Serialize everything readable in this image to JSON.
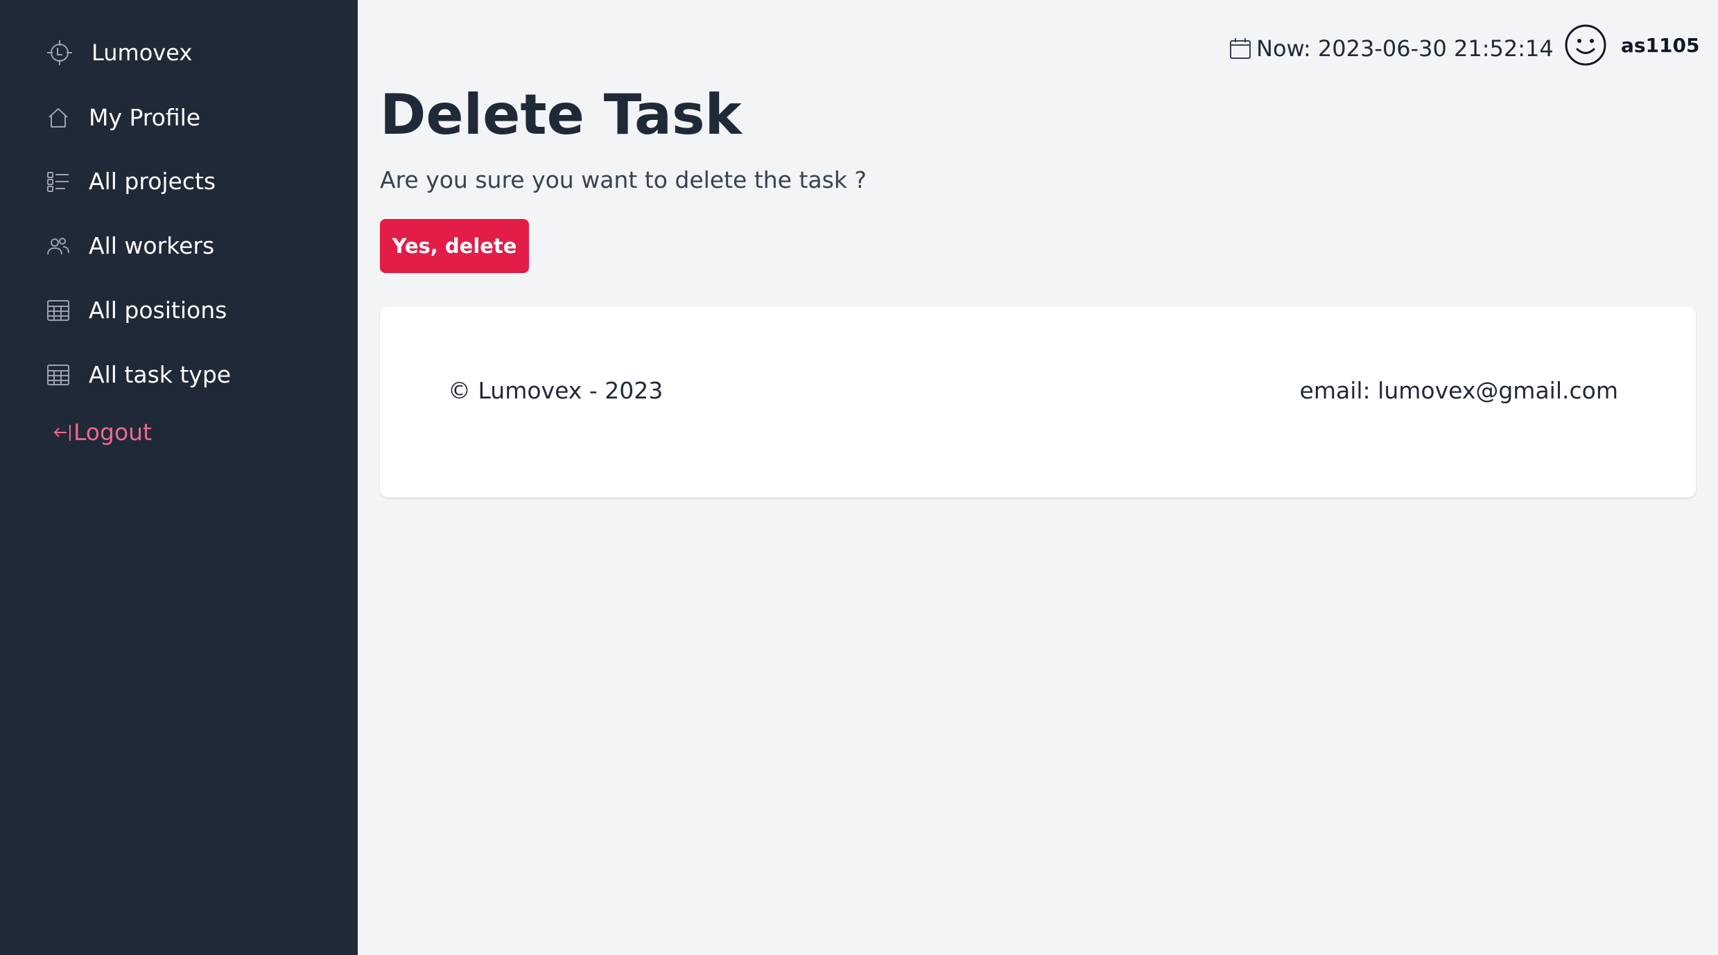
{
  "sidebar": {
    "brand": {
      "label": "Lumovex",
      "icon": "crosshair-clock-icon"
    },
    "items": [
      {
        "label": "My Profile",
        "icon": "home-icon"
      },
      {
        "label": "All projects",
        "icon": "checklist-icon"
      },
      {
        "label": "All workers",
        "icon": "users-icon"
      },
      {
        "label": "All positions",
        "icon": "table-icon"
      },
      {
        "label": "All task type",
        "icon": "table-icon"
      }
    ],
    "logout": {
      "label": "Logout",
      "icon": "logout-arrow-icon"
    }
  },
  "header": {
    "date_label": "Now: 2023-06-30 21:52:14",
    "date_icon": "calendar-icon",
    "username": "as1105",
    "avatar_icon": "smiley-face-icon"
  },
  "main": {
    "title": "Delete Task",
    "confirm_text": "Are you sure you want to delete the task ?",
    "delete_button": "Yes, delete"
  },
  "footer": {
    "copyright": "© Lumovex - 2023",
    "email": "email: lumovex@gmail.com"
  },
  "colors": {
    "sidebar_bg": "#1f2937",
    "page_bg": "#f3f4f6",
    "danger": "#e11d48",
    "logout": "#ec6a93"
  }
}
